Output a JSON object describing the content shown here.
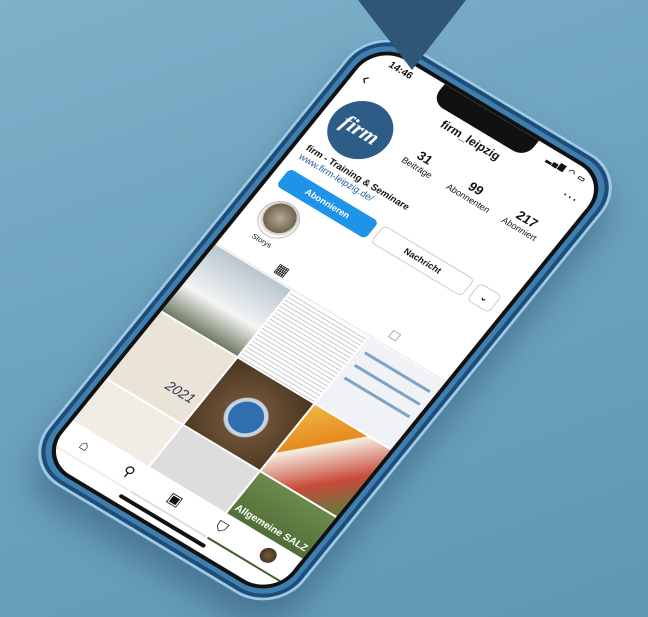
{
  "status": {
    "time": "14:46",
    "icons": "▂▄▆ ◠ ▭"
  },
  "header": {
    "username": "firm_leipzig",
    "back": "‹",
    "more": "···"
  },
  "profile": {
    "logo_text": "firm",
    "stats": [
      {
        "value": "31",
        "label": "Beiträge"
      },
      {
        "value": "99",
        "label": "Abonnenten"
      },
      {
        "value": "217",
        "label": "Abonniert"
      }
    ],
    "name": "firm - Training & Seminare",
    "link": "www.firm-leipzig.de/"
  },
  "buttons": {
    "follow": "Abonnieren",
    "message": "Nachricht",
    "dropdown": "⌄"
  },
  "story": {
    "label": "Storys"
  },
  "tabs": {
    "grid_icon": "▦",
    "tagged_icon": "☐"
  },
  "grid": {
    "post_4_text": "2021",
    "post_9_text": "Allgemeine SALZ"
  },
  "nav": {
    "home": "⌂",
    "search": "⚲",
    "reels": "▣",
    "shop": "⛉"
  },
  "colors": {
    "accent": "#1e93e8",
    "phone_frame": "#3e7fb0",
    "logo_bg": "#2d5d86",
    "pointer": "#2f5675"
  }
}
